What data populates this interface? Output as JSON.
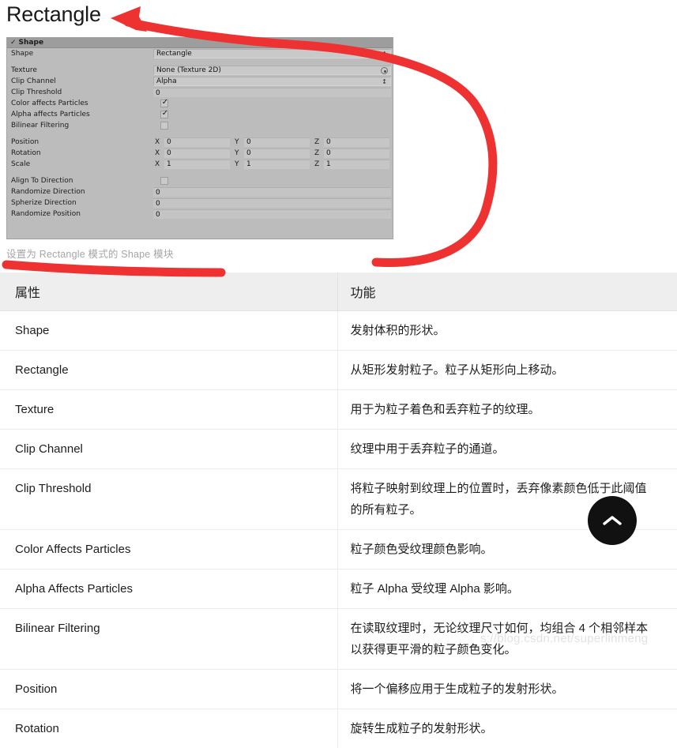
{
  "page": {
    "title": "Rectangle",
    "caption": "设置为 Rectangle 模式的 Shape 模块",
    "watermark": "s://blog.csdn.net/superlinmeng"
  },
  "colors": {
    "annotation_red": "#ee3333",
    "inspector_body": "#bcbcbc",
    "inspector_header": "#9d9d9d",
    "table_header_bg": "#eeeeee",
    "scroll_button_bg": "#111111"
  },
  "inspector": {
    "module_name": "Shape",
    "module_enabled_icon": "check-icon",
    "rows": [
      {
        "kind": "dropdown",
        "label": "Shape",
        "value": "Rectangle"
      },
      {
        "kind": "object",
        "label": "Texture",
        "value": "None (Texture 2D)"
      },
      {
        "kind": "dropdown",
        "label": "Clip Channel",
        "value": "Alpha"
      },
      {
        "kind": "number",
        "label": "Clip Threshold",
        "value": "0"
      },
      {
        "kind": "checkbox",
        "label": "Color affects Particles",
        "checked": true
      },
      {
        "kind": "checkbox",
        "label": "Alpha affects Particles",
        "checked": true
      },
      {
        "kind": "checkbox",
        "label": "Bilinear Filtering",
        "checked": false
      }
    ],
    "vectors": [
      {
        "label": "Position",
        "x": "0",
        "y": "0",
        "z": "0"
      },
      {
        "label": "Rotation",
        "x": "0",
        "y": "0",
        "z": "0"
      },
      {
        "label": "Scale",
        "x": "1",
        "y": "1",
        "z": "1"
      }
    ],
    "axis_labels": {
      "x": "X",
      "y": "Y",
      "z": "Z"
    },
    "rows2": [
      {
        "kind": "checkbox",
        "label": "Align To Direction",
        "checked": false
      },
      {
        "kind": "number",
        "label": "Randomize Direction",
        "value": "0"
      },
      {
        "kind": "number",
        "label": "Spherize Direction",
        "value": "0"
      },
      {
        "kind": "number",
        "label": "Randomize Position",
        "value": "0"
      }
    ]
  },
  "table": {
    "headers": [
      "属性",
      "功能"
    ],
    "rows": [
      {
        "property": "Shape",
        "description": "发射体积的形状。"
      },
      {
        "property": "Rectangle",
        "description": "从矩形发射粒子。粒子从矩形向上移动。"
      },
      {
        "property": "Texture",
        "description": "用于为粒子着色和丢弃粒子的纹理。"
      },
      {
        "property": "Clip Channel",
        "description": "纹理中用于丢弃粒子的通道。"
      },
      {
        "property": "Clip Threshold",
        "description": "将粒子映射到纹理上的位置时，丢弃像素颜色低于此阈值的所有粒子。"
      },
      {
        "property": "Color Affects Particles",
        "description": "粒子颜色受纹理颜色影响。"
      },
      {
        "property": "Alpha Affects Particles",
        "description": "粒子 Alpha 受纹理 Alpha 影响。"
      },
      {
        "property": "Bilinear Filtering",
        "description": "在读取纹理时，无论纹理尺寸如何，均组合 4 个相邻样本以获得更平滑的粒子颜色变化。"
      },
      {
        "property": "Position",
        "description": "将一个偏移应用于生成粒子的发射形状。"
      },
      {
        "property": "Rotation",
        "description": "旋转生成粒子的发射形状。"
      }
    ]
  },
  "scroll_top_button": {
    "icon": "chevron-up-icon",
    "label": ""
  }
}
